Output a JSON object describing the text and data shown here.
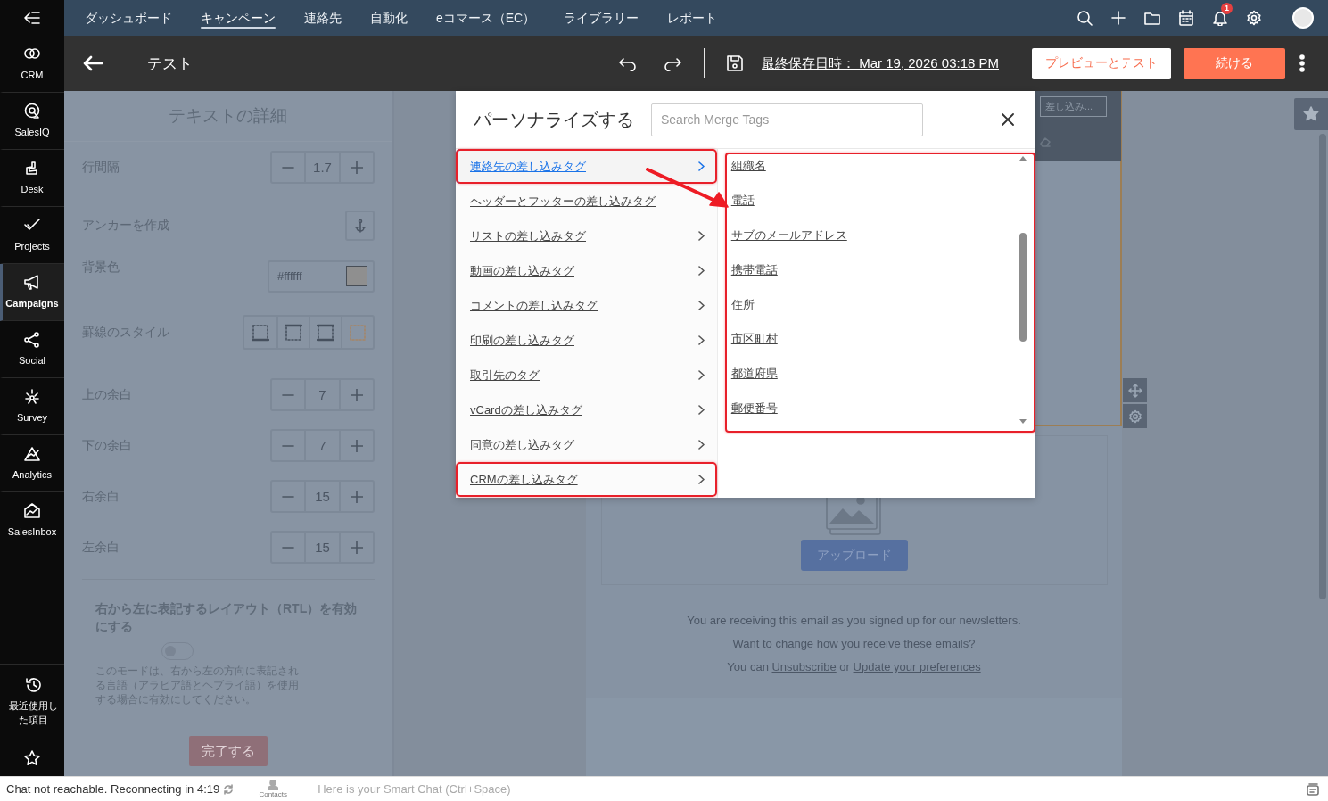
{
  "rail": {
    "items": [
      {
        "label": "CRM",
        "selected": false
      },
      {
        "label": "SalesIQ",
        "selected": false
      },
      {
        "label": "Desk",
        "selected": false
      },
      {
        "label": "Projects",
        "selected": false
      },
      {
        "label": "Campaigns",
        "selected": true
      },
      {
        "label": "Social",
        "selected": false
      },
      {
        "label": "Survey",
        "selected": false
      },
      {
        "label": "Analytics",
        "selected": false
      },
      {
        "label": "SalesInbox",
        "selected": false
      }
    ],
    "recent": "最近使用した項目"
  },
  "top_nav": {
    "tabs": [
      {
        "label": "ダッシュボード",
        "selected": false
      },
      {
        "label": "キャンペーン",
        "selected": true
      },
      {
        "label": "連絡先",
        "selected": false
      },
      {
        "label": "自動化",
        "selected": false
      },
      {
        "label": "eコマース（EC）",
        "selected": false
      },
      {
        "label": "ライブラリー",
        "selected": false
      },
      {
        "label": "レポート",
        "selected": false
      }
    ],
    "notification_count": "1"
  },
  "header": {
    "title": "テスト",
    "last_saved": "最終保存日時： Mar 19, 2026 03:18 PM",
    "preview_button": "プレビューとテスト",
    "continue_button": "続ける"
  },
  "settings_panel": {
    "title": "テキストの詳細",
    "rows": [
      {
        "kind": "stepper",
        "label": "行間隔",
        "value": "1.7"
      },
      {
        "kind": "anchor",
        "label": "アンカーを作成"
      },
      {
        "kind": "color",
        "label": "背景色",
        "value": "#ffffff"
      },
      {
        "kind": "border",
        "label": "罫線のスタイル"
      },
      {
        "kind": "stepper",
        "label": "上の余白",
        "value": "7"
      },
      {
        "kind": "stepper",
        "label": "下の余白",
        "value": "7"
      },
      {
        "kind": "stepper",
        "label": "右余白",
        "value": "15"
      },
      {
        "kind": "stepper",
        "label": "左余白",
        "value": "15"
      }
    ],
    "rtl": {
      "heading": "右から左に表記するレイアウト（RTL）を有効にする",
      "on": false,
      "description": "このモードは、右から左の方向に表記される言語（アラビア語とヘブライ語）を使用する場合に有効にしてください。"
    },
    "done_button": "完了する"
  },
  "canvas": {
    "merge_button": "差し込み...",
    "upload_button": "アップロード",
    "footer": {
      "line_1": "You are receiving this email as you signed up for our newsletters.",
      "line_2": "Want to change how you receive these emails?",
      "prefix": "You can",
      "link_1": "Unsubscribe",
      "middle": "or",
      "link_2": "Update your preferences"
    }
  },
  "modal": {
    "title": "パーソナライズする",
    "search": {
      "placeholder": "Search Merge Tags"
    },
    "categories": [
      {
        "label": "連絡先の差し込みタグ",
        "selected": true,
        "has_submenu": true,
        "highlighted": true
      },
      {
        "label": "ヘッダーとフッターの差し込みタグ",
        "selected": false,
        "has_submenu": false,
        "highlighted": false
      },
      {
        "label": "リストの差し込みタグ",
        "selected": false,
        "has_submenu": true,
        "highlighted": false
      },
      {
        "label": "動画の差し込みタグ",
        "selected": false,
        "has_submenu": true,
        "highlighted": false
      },
      {
        "label": "コメントの差し込みタグ",
        "selected": false,
        "has_submenu": true,
        "highlighted": false
      },
      {
        "label": "印刷の差し込みタグ",
        "selected": false,
        "has_submenu": true,
        "highlighted": false
      },
      {
        "label": "取引先のタグ",
        "selected": false,
        "has_submenu": true,
        "highlighted": false
      },
      {
        "label": "vCardの差し込みタグ",
        "selected": false,
        "has_submenu": true,
        "highlighted": false
      },
      {
        "label": "同意の差し込みタグ",
        "selected": false,
        "has_submenu": true,
        "highlighted": false
      },
      {
        "label": "CRMの差し込みタグ",
        "selected": false,
        "has_submenu": true,
        "highlighted": true
      }
    ],
    "tags": [
      {
        "label": "組織名"
      },
      {
        "label": "電話"
      },
      {
        "label": "サブのメールアドレス"
      },
      {
        "label": "携帯電話"
      },
      {
        "label": "住所"
      },
      {
        "label": "市区町村"
      },
      {
        "label": "都道府県"
      },
      {
        "label": "郵便番号"
      }
    ],
    "tags_highlighted": true,
    "arrow": true
  },
  "status_bar": {
    "chat_status": "Chat not reachable. Reconnecting in 4:19",
    "contacts": "Contacts",
    "chat_placeholder": "Here is your Smart Chat (Ctrl+Space)"
  }
}
